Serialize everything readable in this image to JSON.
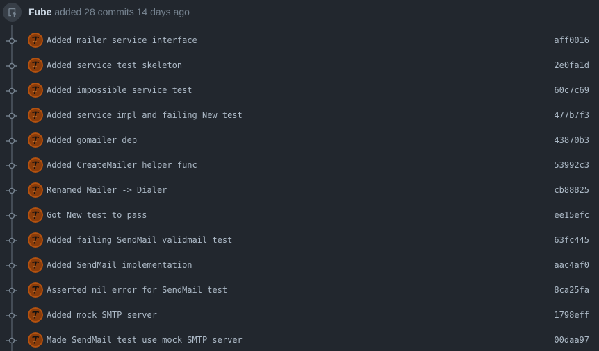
{
  "header": {
    "icon": "repo-push-icon",
    "author": "Fube",
    "action_text": " added 28 commits 14 days ago"
  },
  "commits": [
    {
      "message": "Added mailer service interface",
      "sha": "aff0016"
    },
    {
      "message": "Added service test skeleton",
      "sha": "2e0fa1d"
    },
    {
      "message": "Added impossible service test",
      "sha": "60c7c69"
    },
    {
      "message": "Added service impl and failing New test",
      "sha": "477b7f3"
    },
    {
      "message": "Added gomailer dep",
      "sha": "43870b3"
    },
    {
      "message": "Added CreateMailer helper func",
      "sha": "53992c3"
    },
    {
      "message": "Renamed Mailer -> Dialer",
      "sha": "cb88825"
    },
    {
      "message": "Got New test to pass",
      "sha": "ee15efc"
    },
    {
      "message": "Added failing SendMail validmail test",
      "sha": "63fc445"
    },
    {
      "message": "Added SendMail implementation",
      "sha": "aac4af0"
    },
    {
      "message": "Asserted nil error for SendMail test",
      "sha": "8ca25fa"
    },
    {
      "message": "Added mock SMTP server",
      "sha": "1798eff"
    },
    {
      "message": "Made SendMail test use mock SMTP server",
      "sha": "00daa97"
    }
  ],
  "colors": {
    "background": "#22272e",
    "avatar_orange": "#b5520f",
    "text": "#adbac7",
    "muted": "#768390"
  }
}
